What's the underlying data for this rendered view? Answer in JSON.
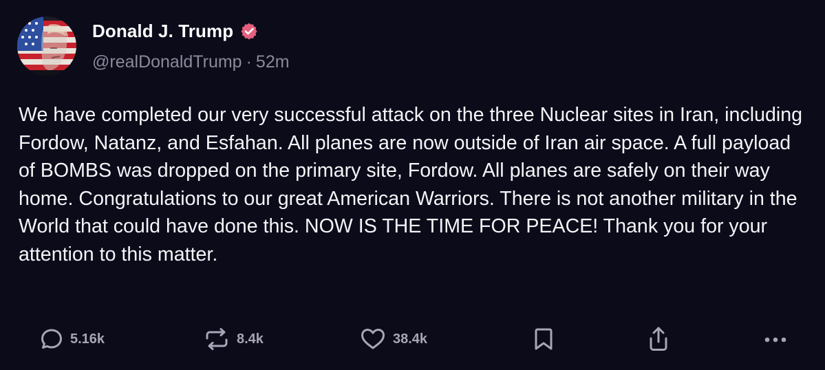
{
  "author": {
    "display_name": "Donald J. Trump",
    "handle": "@realDonaldTrump",
    "separator": "·",
    "time_ago": "52m",
    "verified_color": "#e5607f"
  },
  "post": {
    "text": "We have completed our very successful attack on the three Nuclear sites in Iran, including Fordow, Natanz, and Esfahan. All planes are now outside of Iran air space. A full payload of BOMBS was dropped on the primary site, Fordow. All planes are safely on their way home. Congratulations to our great American Warriors. There is not another military in the World that could have done this. NOW IS THE TIME FOR PEACE! Thank you for your attention to this matter."
  },
  "actions": {
    "replies": {
      "icon": "comment-icon",
      "count": "5.16k"
    },
    "reposts": {
      "icon": "repost-icon",
      "count": "8.4k"
    },
    "likes": {
      "icon": "heart-icon",
      "count": "38.4k"
    },
    "bookmark": {
      "icon": "bookmark-icon"
    },
    "share": {
      "icon": "share-icon"
    },
    "more": {
      "icon": "more-icon"
    }
  },
  "colors": {
    "background": "#0b0b1a",
    "text": "#f4f4f7",
    "muted": "#8b8a9b",
    "icon": "#a7a6b6"
  }
}
